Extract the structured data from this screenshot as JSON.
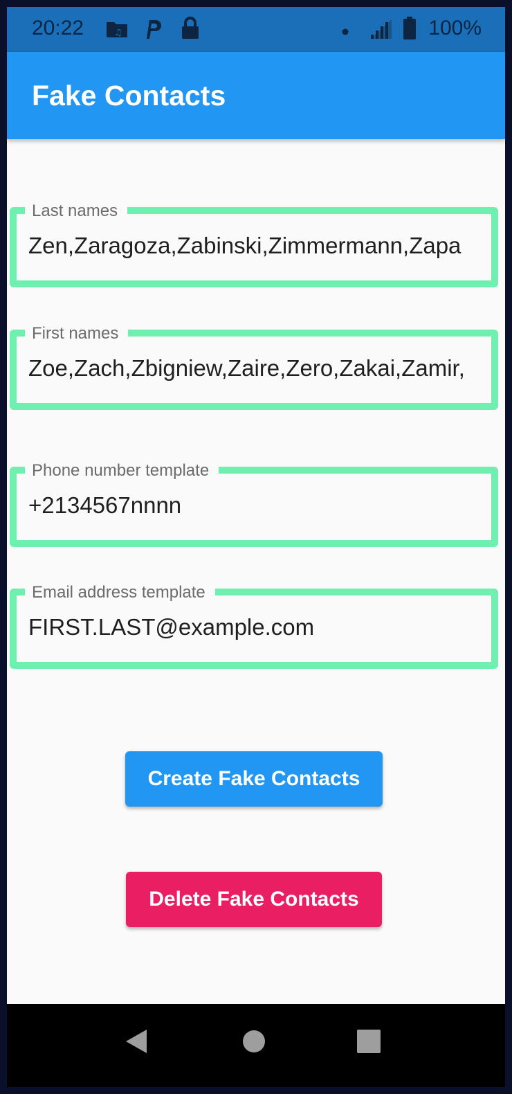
{
  "status_bar": {
    "time": "20:22",
    "battery_text": "100%",
    "icons": [
      "folder-music-icon",
      "p-icon",
      "lock-icon",
      "dot-icon",
      "signal-icon",
      "battery-icon"
    ]
  },
  "app_bar": {
    "title": "Fake Contacts",
    "color": "#2196f3"
  },
  "form": {
    "last_names": {
      "label": "Last names",
      "value": "Zen,Zaragoza,Zabinski,Zimmermann,Zapa"
    },
    "first_names": {
      "label": "First names",
      "value": "Zoe,Zach,Zbigniew,Zaire,Zero,Zakai,Zamir,"
    },
    "phone_template": {
      "label": "Phone number template",
      "value": "+2134567nnnn"
    },
    "email_template": {
      "label": "Email address template",
      "value": "FIRST.LAST@example.com"
    },
    "border_color": "#6ff0b0"
  },
  "actions": {
    "create_label": "Create Fake Contacts",
    "create_color": "#2196f3",
    "delete_label": "Delete Fake Contacts",
    "delete_color": "#e91e63"
  },
  "nav_bar": {
    "icons": [
      "back-icon",
      "home-icon",
      "recents-icon"
    ]
  }
}
